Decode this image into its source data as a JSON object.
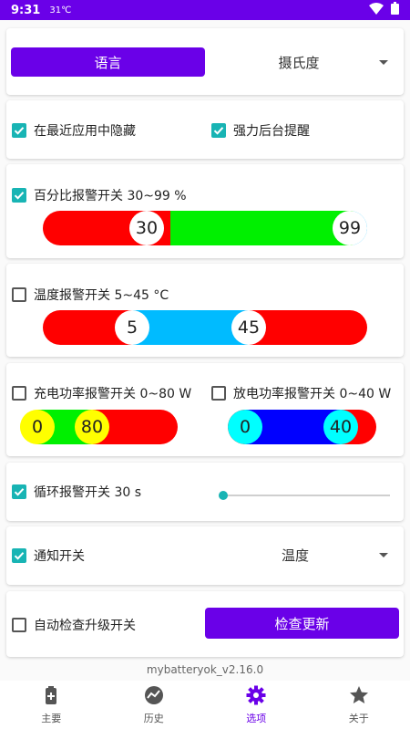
{
  "status": {
    "time": "9:31",
    "temp": "31℃",
    "icons": [
      "wifi-icon",
      "battery-icon"
    ]
  },
  "colors": {
    "primary": "#6a00e8",
    "teal": "#18b4b4",
    "red": "#ff0000",
    "green": "#00f000",
    "cyan": "#00bbff",
    "blue": "#0000ff",
    "yellow": "#ffff00",
    "knob_cyan": "#00ffff"
  },
  "language": {
    "button_label": "语言",
    "unit_select": "摄氏度"
  },
  "options": {
    "hide_recent": {
      "label": "在最近应用中隐藏",
      "checked": true
    },
    "strong_bg": {
      "label": "强力后台提醒",
      "checked": true
    }
  },
  "percent_alarm": {
    "label": "百分比报警开关 30~99 %",
    "checked": true,
    "low": "30",
    "high": "99"
  },
  "temp_alarm": {
    "label": "温度报警开关 5~45 °C",
    "checked": false,
    "low": "5",
    "high": "45"
  },
  "charge_alarm": {
    "label": "充电功率报警开关 0~80 W",
    "checked": false,
    "low": "0",
    "high": "80"
  },
  "discharge_alarm": {
    "label": "放电功率报警开关 0~40 W",
    "checked": false,
    "low": "0",
    "high": "40"
  },
  "cycle_alarm": {
    "label": "循环报警开关 30 s",
    "checked": true,
    "slider_fraction": 0
  },
  "notify": {
    "label": "通知开关",
    "checked": true,
    "select": "温度"
  },
  "update": {
    "label": "自动检查升级开关",
    "checked": false,
    "button_label": "检查更新"
  },
  "version": "mybatteryok_v2.16.0",
  "nav": [
    {
      "label": "主要",
      "icon": "battery-icon",
      "active": false
    },
    {
      "label": "历史",
      "icon": "history-chart-icon",
      "active": false
    },
    {
      "label": "选项",
      "icon": "gear-icon",
      "active": true
    },
    {
      "label": "关于",
      "icon": "star-icon",
      "active": false
    }
  ]
}
